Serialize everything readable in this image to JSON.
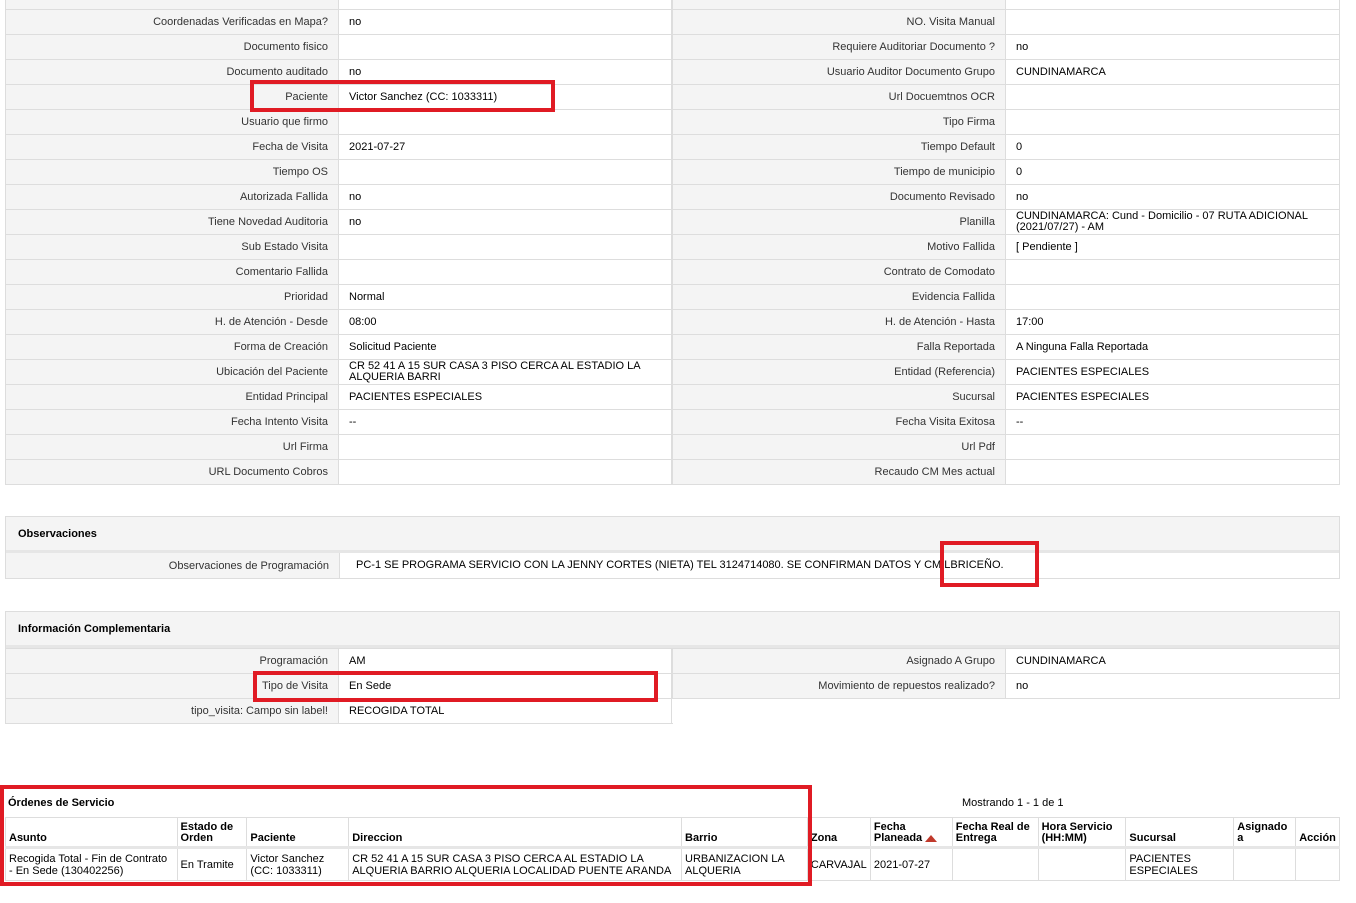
{
  "details": [
    [
      "Coordenadas Verificadas en Mapa?",
      "no",
      "NO. Visita Manual",
      ""
    ],
    [
      "Documento fisico",
      "",
      "Requiere Auditoriar Documento ?",
      "no"
    ],
    [
      "Documento auditado",
      "no",
      "Usuario Auditor Documento Grupo",
      "CUNDINAMARCA"
    ],
    [
      "Paciente",
      "Victor Sanchez (CC: 1033311)",
      "Url Docuemtnos OCR",
      ""
    ],
    [
      "Usuario que firmo",
      "",
      "Tipo Firma",
      ""
    ],
    [
      "Fecha de Visita",
      "2021-07-27",
      "Tiempo Default",
      "0"
    ],
    [
      "Tiempo OS",
      "",
      "Tiempo de municipio",
      "0"
    ],
    [
      "Autorizada Fallida",
      "no",
      "Documento Revisado",
      "no"
    ],
    [
      "Tiene Novedad Auditoria",
      "no",
      "Planilla",
      "CUNDINAMARCA: Cund - Domicilio - 07 RUTA ADICIONAL (2021/07/27) - AM"
    ],
    [
      "Sub Estado Visita",
      "",
      "Motivo Fallida",
      "[ Pendiente ]"
    ],
    [
      "Comentario Fallida",
      "",
      "Contrato de Comodato",
      ""
    ],
    [
      "Prioridad",
      "Normal",
      "Evidencia Fallida",
      ""
    ],
    [
      "H. de Atención - Desde",
      "08:00",
      "H. de Atención - Hasta",
      "17:00"
    ],
    [
      "Forma de Creación",
      "Solicitud Paciente",
      "Falla Reportada",
      "A Ninguna Falla Reportada"
    ],
    [
      "Ubicación del Paciente",
      "CR 52 41 A 15 SUR CASA 3 PISO CERCA AL ESTADIO LA ALQUERIA BARRI",
      "Entidad (Referencia)",
      "PACIENTES ESPECIALES"
    ],
    [
      "Entidad Principal",
      "PACIENTES ESPECIALES",
      "Sucursal",
      "PACIENTES ESPECIALES"
    ],
    [
      "Fecha Intento Visita",
      "--",
      "Fecha Visita Exitosa",
      "--"
    ],
    [
      "Url Firma",
      "",
      "Url Pdf",
      ""
    ],
    [
      "URL Documento Cobros",
      "",
      "Recaudo CM Mes actual",
      ""
    ]
  ],
  "observaciones": {
    "title": "Observaciones",
    "label": "Observaciones de Programación",
    "value": "PC-1 SE PROGRAMA SERVICIO CON LA JENNY CORTES (NIETA) TEL 3124714080. SE CONFIRMAN DATOS Y CM LBRICEÑO."
  },
  "complementaria": {
    "title": "Información Complementaria",
    "rows": [
      [
        "Programación",
        "AM",
        "Asignado A Grupo",
        "CUNDINAMARCA"
      ],
      [
        "Tipo de Visita",
        "En Sede",
        "Movimiento de repuestos realizado?",
        "no"
      ],
      [
        "tipo_visita: Campo sin label!",
        "RECOGIDA TOTAL"
      ]
    ]
  },
  "ordenes": {
    "title": "Órdenes de Servicio",
    "showing": "Mostrando 1 - 1 de 1",
    "headers": [
      "Asunto",
      "Estado de Orden",
      "Paciente",
      "Direccion",
      "Barrio",
      "Zona",
      "Fecha Planeada",
      "Fecha Real de Entrega",
      "Hora Servicio (HH:MM)",
      "Sucursal",
      "Asignado a",
      "Acción"
    ],
    "rows": [
      [
        "Recogida Total - Fin de Contrato - En Sede (130402256)",
        "En Tramite",
        "Victor Sanchez (CC: 1033311)",
        "CR 52 41 A 15 SUR CASA 3 PISO CERCA AL ESTADIO LA ALQUERIA BARRIO ALQUERIA LOCALIDAD PUENTE ARANDA",
        "URBANIZACION LA ALQUERIA",
        "CARVAJAL",
        "2021-07-27",
        "",
        "",
        "PACIENTES ESPECIALES",
        "",
        ""
      ]
    ]
  },
  "colors": {
    "highlight": "#e01b24",
    "label_bg": "#f4f4f4",
    "border": "#dddddd"
  }
}
